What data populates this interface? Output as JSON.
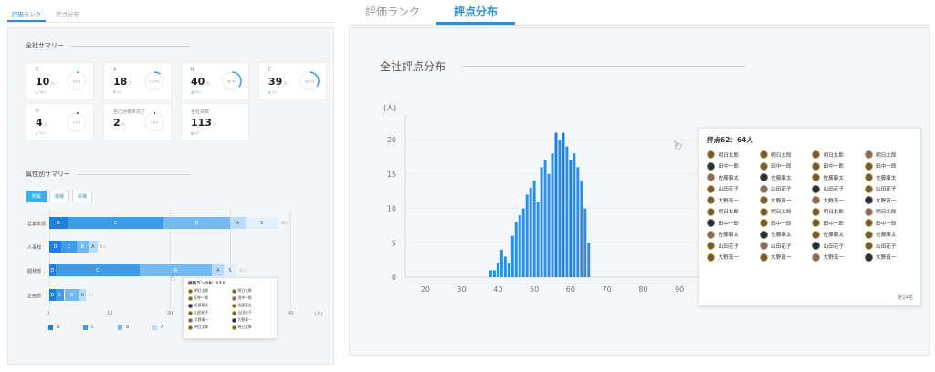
{
  "left": {
    "tabs": [
      {
        "label": "評価ランク"
      },
      {
        "label": "評点分布"
      }
    ],
    "company_summary_title": "全社サマリー",
    "cards": [
      {
        "label": "S",
        "value": "10",
        "unit": "人",
        "pct": "4.0%",
        "fill": 0.04,
        "delta": "▲ 16人",
        "color": "#3a9ee8"
      },
      {
        "label": "A",
        "value": "18",
        "unit": "人",
        "pct": "10.9%",
        "fill": 0.109,
        "delta": "▼ 2人",
        "color": "#3a9ee8"
      },
      {
        "label": "B",
        "value": "40",
        "unit": "人",
        "pct": "35.4%",
        "fill": 0.354,
        "delta": "▲ 10人",
        "color": "#3a9ee8"
      },
      {
        "label": "C",
        "value": "39",
        "unit": "人",
        "pct": "34.5%",
        "fill": 0.345,
        "delta": "▲ 4人",
        "color": "#3a9ee8"
      },
      {
        "label": "D",
        "value": "4",
        "unit": "人",
        "pct": "3.5%",
        "fill": 0.035,
        "delta": "▲ 10人",
        "color": "#1a4d8c"
      },
      {
        "label": "自己評価未完了",
        "value": "2",
        "unit": "人",
        "pct": "1.6%",
        "fill": 0.016,
        "delta": "",
        "color": "#222222"
      },
      {
        "label": "全社員数",
        "value": "113",
        "unit": "人",
        "pct": "",
        "fill": 0,
        "delta": "▲ 4人",
        "color": "#3a9ee8"
      }
    ],
    "attr_summary_title": "属性別サマリー",
    "filters": [
      {
        "label": "所属",
        "active": true
      },
      {
        "label": "職種",
        "active": false
      },
      {
        "label": "役職",
        "active": false
      }
    ],
    "rows": [
      {
        "label": "営業本部",
        "total": "38人",
        "segments": [
          {
            "label": "D",
            "value": 3
          },
          {
            "label": "C",
            "value": 16
          },
          {
            "label": "B",
            "value": 11
          },
          {
            "label": "A",
            "value": 2.5
          },
          {
            "label": "S",
            "value": 5.5
          }
        ]
      },
      {
        "label": "人事部",
        "total": "8人",
        "segments": [
          {
            "label": "D",
            "value": 2
          },
          {
            "label": "C",
            "value": 2.5
          },
          {
            "label": "B",
            "value": 2
          },
          {
            "label": "A",
            "value": 1.5
          },
          {
            "label": "S",
            "value": 0
          }
        ]
      },
      {
        "label": "開発部",
        "total": "31人",
        "segments": [
          {
            "label": "D",
            "value": 1
          },
          {
            "label": "C",
            "value": 14
          },
          {
            "label": "B",
            "value": 12
          },
          {
            "label": "A",
            "value": 2
          },
          {
            "label": "S",
            "value": 2
          }
        ]
      },
      {
        "label": "企画部",
        "total": "6人",
        "segments": [
          {
            "label": "D",
            "value": 1
          },
          {
            "label": "C",
            "value": 1.5
          },
          {
            "label": "B",
            "value": 2.5
          },
          {
            "label": "A",
            "value": 1
          },
          {
            "label": "S",
            "value": 0
          }
        ]
      }
    ],
    "x_ticks": [
      "0",
      "10",
      "20",
      "30",
      "40"
    ],
    "x_unit": "(人)",
    "legend": [
      {
        "label": "D",
        "color": "#1e7fdc"
      },
      {
        "label": "C",
        "color": "#3c9cea"
      },
      {
        "label": "B",
        "color": "#73baf2"
      },
      {
        "label": "A",
        "color": "#b9dcf8"
      }
    ],
    "tooltip": {
      "title": "評価ランクB：17人",
      "people": [
        "明日太郎",
        "明日太郎",
        "田中一郎",
        "田中一郎",
        "佐藤康太",
        "佐藤康太",
        "山田花子",
        "山田花子",
        "大野真一",
        "大野真一",
        "明日太郎",
        "明日太郎"
      ]
    }
  },
  "right": {
    "tabs": [
      {
        "label": "評価ランク"
      },
      {
        "label": "評点分布"
      }
    ],
    "section_title": "全社評点分布",
    "y_unit": "(人)",
    "tooltip": {
      "title": "評点62：64人",
      "people": [
        "明日太郎",
        "明日太郎",
        "明日太郎",
        "明日太郎",
        "田中一郎",
        "田中一郎",
        "田中一郎",
        "田中一郎",
        "佐藤康太",
        "佐藤康太",
        "佐藤康太",
        "佐藤康太",
        "山田花子",
        "山田花子",
        "山田花子",
        "山田花子",
        "大野真一",
        "大野真一",
        "大野真一",
        "大野真一",
        "明日太郎",
        "明日太郎",
        "明日太郎",
        "明日太郎",
        "田中一郎",
        "田中一郎",
        "田中一郎",
        "田中一郎",
        "佐藤康太",
        "佐藤康太",
        "佐藤康太",
        "佐藤康太",
        "山田花子",
        "山田花子",
        "山田花子",
        "山田花子",
        "大野真一",
        "大野真一",
        "大野真一",
        "大野真一"
      ],
      "more": "他24名"
    },
    "chart_data": {
      "type": "bar",
      "x_ticks": [
        20,
        30,
        40,
        50,
        60,
        70,
        80,
        90
      ],
      "y_ticks": [
        0,
        5,
        10,
        15,
        20
      ],
      "ylim": [
        0,
        22
      ],
      "xlim": [
        14.5,
        97
      ],
      "x": [
        38,
        39,
        40,
        41,
        42,
        43,
        44,
        45,
        46,
        47,
        48,
        49,
        50,
        51,
        52,
        53,
        54,
        55,
        56,
        57,
        58,
        59,
        60,
        61,
        62,
        63,
        64,
        65
      ],
      "values": [
        1,
        1,
        2,
        4,
        3,
        2,
        6,
        8,
        9,
        10,
        12,
        13,
        14,
        11,
        16,
        17,
        15,
        18,
        21,
        20,
        21,
        19,
        17,
        18,
        16,
        14,
        10,
        5
      ]
    }
  }
}
